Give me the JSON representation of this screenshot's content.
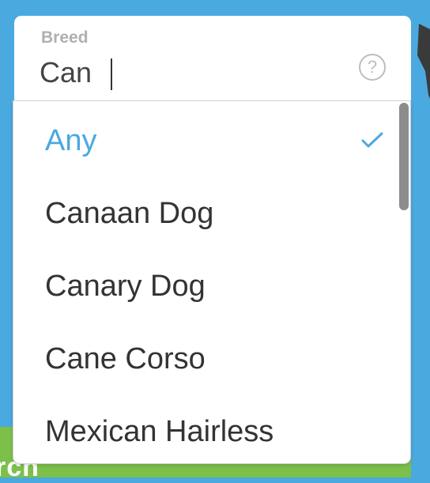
{
  "field": {
    "label": "Breed",
    "value": "Can",
    "help_icon": "question-circle-icon",
    "help_glyph": "?"
  },
  "dropdown": {
    "options": [
      {
        "label": "Any",
        "selected": true
      },
      {
        "label": "Canaan Dog",
        "selected": false
      },
      {
        "label": "Canary Dog",
        "selected": false
      },
      {
        "label": "Cane Corso",
        "selected": false
      },
      {
        "label": "Mexican Hairless",
        "selected": false
      }
    ],
    "check_icon": "checkmark-icon"
  },
  "background": {
    "partial_button_text": "rch"
  },
  "colors": {
    "accent": "#4aa9df",
    "background": "#4aa9df",
    "button_green": "#7cc04a",
    "text": "#333333",
    "label": "#b0b0b0"
  }
}
